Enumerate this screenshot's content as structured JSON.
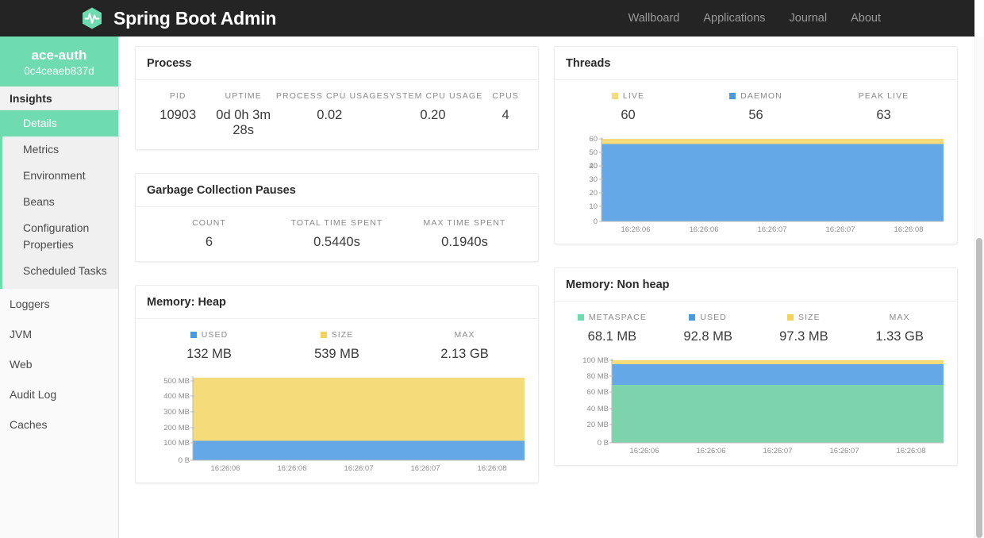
{
  "navbar": {
    "brand": "Spring Boot Admin",
    "logo_icon": "heartbeat-hexagon-icon",
    "links": [
      {
        "label": "Wallboard"
      },
      {
        "label": "Applications"
      },
      {
        "label": "Journal"
      },
      {
        "label": "About"
      }
    ]
  },
  "sidebar": {
    "app_name": "ace-auth",
    "app_id": "0c4ceaeb837d",
    "section_label": "Insights",
    "submenu": [
      {
        "label": "Details",
        "active": true
      },
      {
        "label": "Metrics",
        "active": false
      },
      {
        "label": "Environment",
        "active": false
      },
      {
        "label": "Beans",
        "active": false
      },
      {
        "label": "Configuration Properties",
        "active": false
      },
      {
        "label": "Scheduled Tasks",
        "active": false
      }
    ],
    "items": [
      {
        "label": "Loggers"
      },
      {
        "label": "JVM"
      },
      {
        "label": "Web"
      },
      {
        "label": "Audit Log"
      },
      {
        "label": "Caches"
      }
    ]
  },
  "colors": {
    "accent_green": "#6edcb0",
    "navbar_bg": "#242424",
    "series_blue": "#64a8e8",
    "series_yellow": "#f5db79",
    "series_green": "#7dd4ac"
  },
  "cards": {
    "process": {
      "title": "Process",
      "stats": [
        {
          "label": "PID",
          "value": "10903"
        },
        {
          "label": "Uptime",
          "value": "0d 0h 3m 28s"
        },
        {
          "label": "Process CPU Usage",
          "value": "0.02"
        },
        {
          "label": "System CPU Usage",
          "value": "0.20"
        },
        {
          "label": "CPUs",
          "value": "4"
        }
      ]
    },
    "gc": {
      "title": "Garbage Collection Pauses",
      "stats": [
        {
          "label": "Count",
          "value": "6"
        },
        {
          "label": "Total time spent",
          "value": "0.5440s"
        },
        {
          "label": "Max time spent",
          "value": "0.1940s"
        }
      ]
    },
    "threads": {
      "title": "Threads",
      "stats": [
        {
          "label": "Live",
          "value": "60",
          "color": "#f5db79"
        },
        {
          "label": "Daemon",
          "value": "56",
          "color": "#4a9ae0"
        },
        {
          "label": "Peak live",
          "value": "63",
          "color": null
        }
      ]
    },
    "heap": {
      "title": "Memory: Heap",
      "stats": [
        {
          "label": "Used",
          "value": "132 MB",
          "color": "#4a9ae0"
        },
        {
          "label": "Size",
          "value": "539 MB",
          "color": "#f2d35e"
        },
        {
          "label": "Max",
          "value": "2.13 GB",
          "color": null
        }
      ]
    },
    "nonheap": {
      "title": "Memory: Non heap",
      "stats": [
        {
          "label": "Metaspace",
          "value": "68.1 MB",
          "color": "#6edcb0"
        },
        {
          "label": "Used",
          "value": "92.8 MB",
          "color": "#4a9ae0"
        },
        {
          "label": "Size",
          "value": "97.3 MB",
          "color": "#f2d35e"
        },
        {
          "label": "Max",
          "value": "1.33 GB",
          "color": null
        }
      ]
    }
  },
  "chart_data": [
    {
      "id": "threads-chart",
      "type": "area",
      "title": "Threads",
      "xlabel": "",
      "ylabel": "",
      "ylim": [
        0,
        63
      ],
      "yticks": [
        "0",
        "10",
        "20",
        "30",
        "40",
        "50",
        "60"
      ],
      "ytick_values": [
        0,
        10,
        20,
        30,
        40,
        50,
        60
      ],
      "xticks": [
        "16:26:06",
        "16:26:06",
        "16:26:07",
        "16:26:07",
        "16:26:08"
      ],
      "grid": false,
      "legend": "top",
      "series": [
        {
          "name": "Live",
          "color": "#f5db79",
          "values": [
            60,
            60,
            60,
            60,
            60
          ]
        },
        {
          "name": "Daemon",
          "color": "#64a8e8",
          "values": [
            56,
            56,
            56,
            56,
            56
          ]
        }
      ]
    },
    {
      "id": "heap-chart",
      "type": "area",
      "title": "Memory: Heap",
      "xlabel": "",
      "ylabel": "",
      "ylim": [
        0,
        560
      ],
      "yticks": [
        "500 MB",
        "400 MB",
        "300 MB",
        "200 MB",
        "100 MB",
        "0 B"
      ],
      "ytick_values": [
        500,
        400,
        300,
        200,
        100,
        0
      ],
      "xticks": [
        "16:26:06",
        "16:26:06",
        "16:26:07",
        "16:26:07",
        "16:26:08"
      ],
      "grid": false,
      "legend": "top",
      "series": [
        {
          "name": "Size",
          "color": "#f5db79",
          "values": [
            539,
            539,
            539,
            539,
            539
          ]
        },
        {
          "name": "Used",
          "color": "#64a8e8",
          "values": [
            132,
            132,
            132,
            132,
            132
          ]
        }
      ]
    },
    {
      "id": "nonheap-chart",
      "type": "area",
      "title": "Memory: Non heap",
      "xlabel": "",
      "ylabel": "",
      "ylim": [
        0,
        103
      ],
      "yticks": [
        "100 MB",
        "80 MB",
        "60 MB",
        "40 MB",
        "20 MB",
        "0 B"
      ],
      "ytick_values": [
        100,
        80,
        60,
        40,
        20,
        0
      ],
      "xticks": [
        "16:26:06",
        "16:26:06",
        "16:26:07",
        "16:26:07",
        "16:26:08"
      ],
      "grid": false,
      "legend": "top",
      "series": [
        {
          "name": "Size",
          "color": "#f5db79",
          "values": [
            97.3,
            97.3,
            97.3,
            97.3,
            97.3
          ]
        },
        {
          "name": "Used",
          "color": "#64a8e8",
          "values": [
            92.8,
            92.8,
            92.8,
            92.8,
            92.8
          ]
        },
        {
          "name": "Metaspace",
          "color": "#7dd4ac",
          "values": [
            68.1,
            68.1,
            68.1,
            68.1,
            68.1
          ]
        }
      ]
    }
  ]
}
